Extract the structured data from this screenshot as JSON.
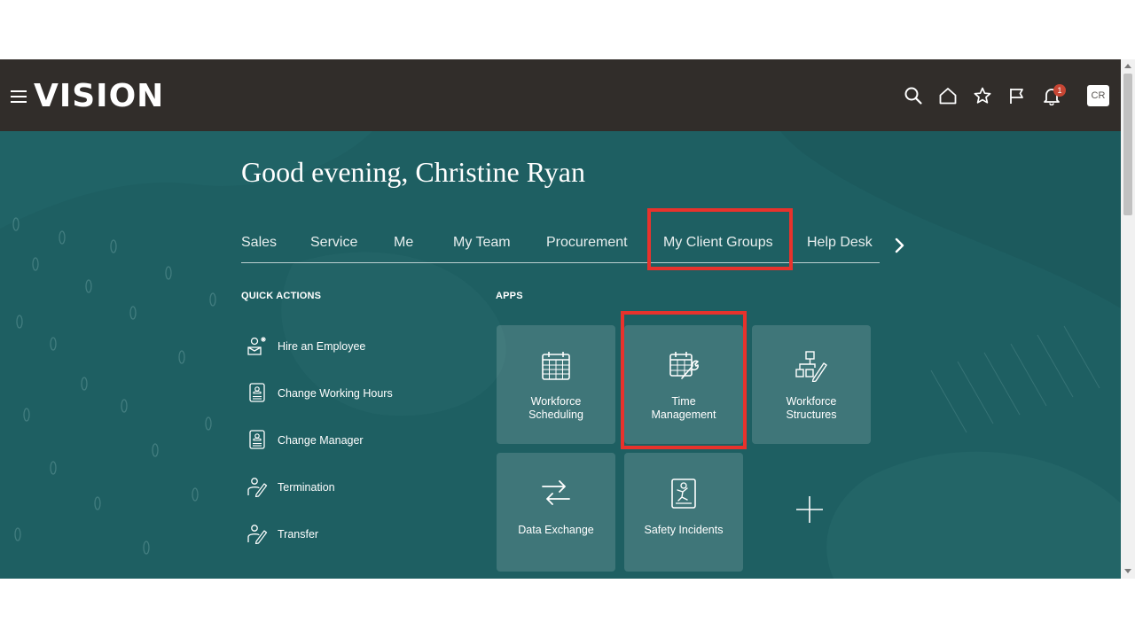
{
  "app": {
    "logo": "VISION"
  },
  "header": {
    "icons": [
      "search-icon",
      "home-icon",
      "favorites-star-icon",
      "flag-icon",
      "notifications-bell-icon"
    ],
    "notification_count": "1",
    "user_initials": "CR"
  },
  "greeting": "Good evening, Christine Ryan",
  "tabs": [
    {
      "label": "Sales"
    },
    {
      "label": "Service"
    },
    {
      "label": "Me"
    },
    {
      "label": "My Team"
    },
    {
      "label": "Procurement"
    },
    {
      "label": "My Client Groups",
      "highlighted": true
    },
    {
      "label": "Help Desk"
    }
  ],
  "quick_actions": {
    "title": "QUICK ACTIONS",
    "items": [
      {
        "label": "Hire an Employee",
        "icon": "hire-employee-icon"
      },
      {
        "label": "Change Working Hours",
        "icon": "document-person-icon"
      },
      {
        "label": "Change Manager",
        "icon": "document-person-icon"
      },
      {
        "label": "Termination",
        "icon": "person-edit-icon"
      },
      {
        "label": "Transfer",
        "icon": "person-edit-icon"
      }
    ]
  },
  "apps": {
    "title": "APPS",
    "tiles": [
      {
        "label": "Workforce\nScheduling",
        "icon": "calendar-icon"
      },
      {
        "label": "Time\nManagement",
        "icon": "calendar-wrench-icon",
        "highlighted": true
      },
      {
        "label": "Workforce\nStructures",
        "icon": "org-chart-edit-icon"
      },
      {
        "label": "Data Exchange",
        "icon": "exchange-arrows-icon"
      },
      {
        "label": "Safety Incidents",
        "icon": "safety-incident-icon"
      }
    ],
    "add_icon": "plus-icon"
  },
  "colors": {
    "topbar": "#312d2a",
    "hero": "#1e5f62",
    "highlight": "#e8322c",
    "badge": "#c74634"
  }
}
